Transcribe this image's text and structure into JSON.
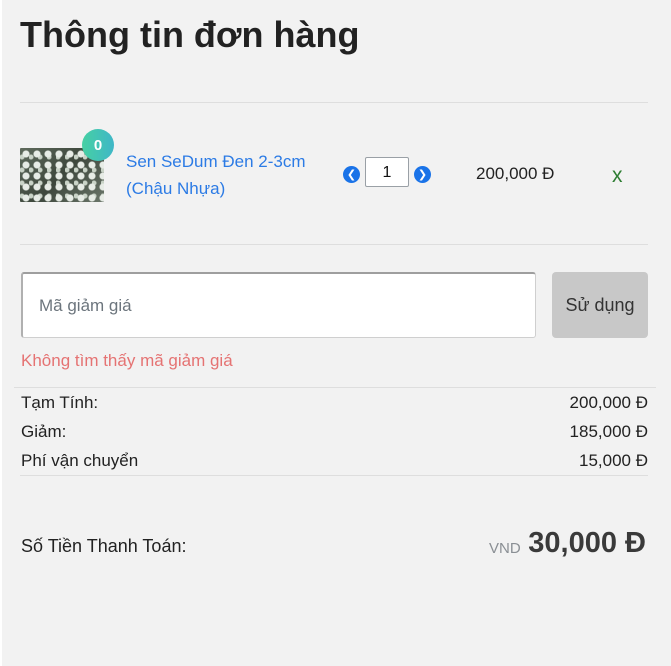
{
  "page": {
    "title": "Thông tin đơn hàng"
  },
  "cart_item": {
    "badge": "0",
    "name": "Sen SeDum Đen 2-3cm (Chậu Nhựa)",
    "quantity": "1",
    "price": "200,000 Đ",
    "remove_label": "x",
    "icons": {
      "decrease": "chevron-left-circle-icon",
      "increase": "chevron-right-circle-icon"
    }
  },
  "coupon": {
    "placeholder": "Mã giảm giá",
    "value": "",
    "apply_label": "Sử dụng",
    "error": "Không tìm thấy mã giảm giá"
  },
  "summary": [
    {
      "label": "Tạm Tính:",
      "value": "200,000 Đ"
    },
    {
      "label": "Giảm:",
      "value": "185,000 Đ"
    },
    {
      "label": "Phí vận chuyển",
      "value": "15,000 Đ"
    }
  ],
  "total": {
    "label": "Số Tiền Thanh Toán:",
    "currency": "VND",
    "amount": "30,000 Đ"
  },
  "colors": {
    "link": "#2c7be5",
    "error": "#e57373",
    "remove": "#2e7d32",
    "badge": "#46d0a3"
  }
}
